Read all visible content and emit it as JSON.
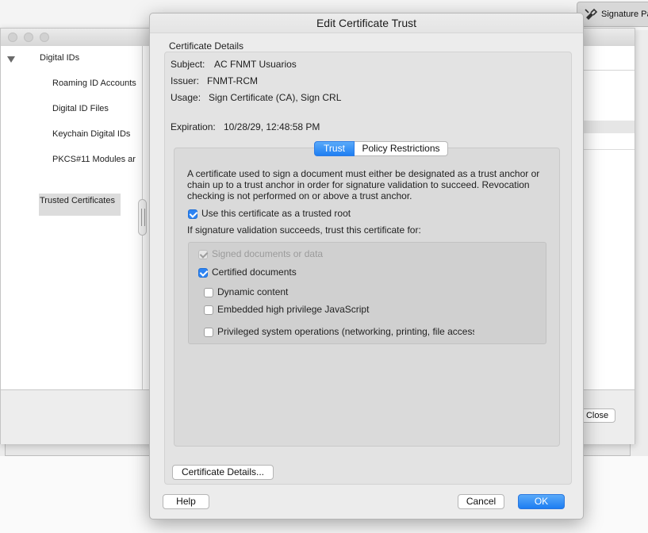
{
  "background": {
    "signature_panel_label": "Signature Pa",
    "sidebar": {
      "root": "Digital IDs",
      "items": [
        "Roaming ID Accounts",
        "Digital ID Files",
        "Keychain Digital IDs",
        "PKCS#11 Modules ar"
      ],
      "selected": "Trusted Certificates"
    },
    "close_label": "Close"
  },
  "dialog": {
    "title": "Edit Certificate Trust",
    "details_group_label": "Certificate Details",
    "subject": {
      "label": "Subject:",
      "value": "AC FNMT Usuarios"
    },
    "issuer": {
      "label": "Issuer:",
      "value": "FNMT-RCM"
    },
    "usage": {
      "label": "Usage:",
      "value": "Sign Certificate (CA), Sign CRL"
    },
    "expiration": {
      "label": "Expiration:",
      "value": "10/28/29, 12:48:58 PM"
    },
    "tabs": [
      {
        "label": "Trust",
        "active": true
      },
      {
        "label": "Policy Restrictions",
        "active": false
      }
    ],
    "trust": {
      "description": "A certificate used to sign a document must either be designated as a trust anchor or chain up to a trust anchor in order for signature validation to succeed.  Revocation checking is not performed on or above a trust anchor.",
      "trusted_root": {
        "label": "Use this certificate as a trusted root",
        "checked": true
      },
      "trust_for_label": "If signature validation succeeds, trust this certificate for:",
      "options": [
        {
          "label": "Signed documents or data",
          "checked": true,
          "disabled": true
        },
        {
          "label": "Certified documents",
          "checked": true,
          "disabled": false
        },
        {
          "label": "Dynamic content",
          "checked": false,
          "disabled": false
        },
        {
          "label": "Embedded high privilege JavaScript",
          "checked": false,
          "disabled": false
        },
        {
          "label": "Privileged system operations (networking, printing, file access",
          "checked": false,
          "disabled": false
        }
      ]
    },
    "certificate_details_button": "Certificate Details...",
    "help_button": "Help",
    "cancel_button": "Cancel",
    "ok_button": "OK"
  },
  "colors": {
    "accent": "#1e7ef2",
    "checkbox_checked": "#2d84f3"
  }
}
